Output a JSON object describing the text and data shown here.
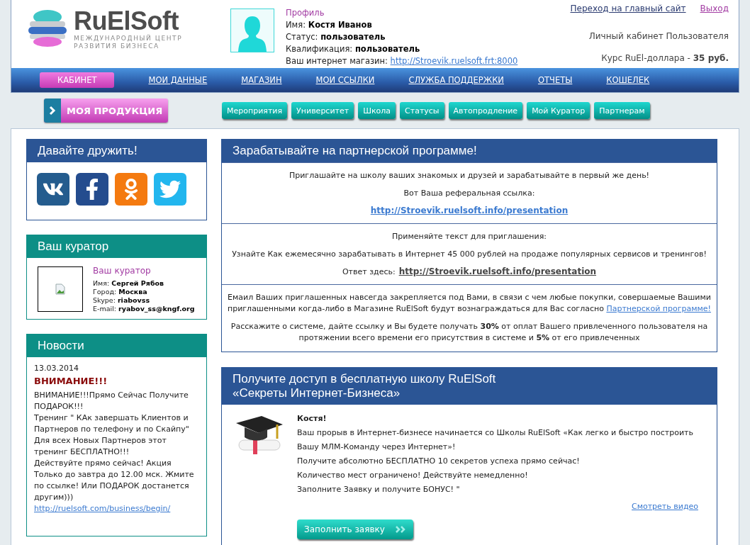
{
  "header": {
    "logo": {
      "name": "RuElSoft",
      "tagline": [
        "МЕЖДУНАРОДНЫЙ ЦЕНТР",
        "РАЗВИТИЯ БИЗНЕСА"
      ]
    },
    "profile": {
      "title": "Профиль",
      "fields": [
        {
          "label": "Имя:",
          "value": "Костя Иванов"
        },
        {
          "label": "Статус:",
          "value": "пользователь"
        },
        {
          "label": "Квалификация:",
          "value": "пользователь"
        }
      ],
      "shop_label": "Ваш интернет магазин:",
      "shop_link": "http://Stroevik.ruelsoft.frt:8000"
    },
    "links": [
      {
        "label": "Переход на главный сайт",
        "kind": "main"
      },
      {
        "label": "Выход",
        "kind": "exit"
      }
    ],
    "cabinet_label": "Личный кабинет Пользователя",
    "rate": {
      "label": "Курс RuEl-доллара -",
      "value": "35 руб."
    }
  },
  "nav": [
    {
      "label": "КАБИНЕТ",
      "selected": true
    },
    {
      "label": "МОИ ДАННЫЕ",
      "selected": false
    },
    {
      "label": "МАГАЗИН",
      "selected": false
    },
    {
      "label": "МОИ ССЫЛКИ",
      "selected": false
    },
    {
      "label": "СЛУЖБА ПОДДЕРЖКИ",
      "selected": false
    },
    {
      "label": "ОТЧЕТЫ",
      "selected": false
    },
    {
      "label": "КОШЕЛЕК",
      "selected": false
    }
  ],
  "product_button": "МОЯ ПРОДУКЦИЯ",
  "subnav": [
    "Мероприятия",
    "Университет",
    "Школа",
    "Статусы",
    "Автопродление",
    "Мой Куратор",
    "Партнерам"
  ],
  "friends": {
    "title": "Давайте дружить!"
  },
  "curator": {
    "title": "Ваш куратор",
    "subtitle": "Ваш куратор",
    "fields": [
      {
        "label": "Имя:",
        "value": "Сергей Рябов"
      },
      {
        "label": "Город:",
        "value": "Москва"
      },
      {
        "label": "Skype:",
        "value": "riabovss"
      },
      {
        "label": "E-mail:",
        "value": "ryabov_ss@kngf.org"
      }
    ]
  },
  "news": {
    "title": "Новости",
    "date": "13.03.2014",
    "headline": "ВНИМАНИЕ!!!",
    "lines": [
      "ВНИМАНИЕ!!!Прямо Сейчас Получите ПОДАРОК!!!",
      "Тренинг \" КАк завершать Клиентов и Партнеров по телефону и по Скайпу\"",
      "Для всех Новых Партнеров этот тренинг БЕСПЛАТНО!!!",
      "Действуйте прямо сейчас! Акция Только до завтра до 12.00 мск. Жмите по ссылке! Или ПОДАРОК достанется другим)))"
    ],
    "link": "http://ruelsoft.com/business/begin/"
  },
  "partner": {
    "title": "Зарабатывайте на партнерской программе!",
    "sections": [
      {
        "paragraphs": [
          {
            "kind": "text",
            "text": "Приглашайте на школу ваших знакомых и друзей и зарабатывайте в первый же день!"
          },
          {
            "kind": "text",
            "text": "Вот Ваша реферальная ссылка:"
          },
          {
            "kind": "link",
            "link": "http://Stroevik.ruelsoft.info/presentation"
          }
        ]
      },
      {
        "paragraphs": [
          {
            "kind": "text",
            "text": "Применяйте текст для приглашения:"
          },
          {
            "kind": "text",
            "text": "Узнайте Как ежемесячно зарабатывать в Интернет 45 000 рублей на продаже популярных сервисов и тренингов!"
          },
          {
            "kind": "answer",
            "text": "Ответ здесь:",
            "link": "http://Stroevik.ruelsoft.info/presentation"
          }
        ]
      },
      {
        "paragraphs": [
          {
            "kind": "inline",
            "text": "Емаил Ваших приглашенных навсегда закрепляется под Вами, в связи с чем любые покупки, совершаемые Вашими приглашенными когда-либо в Магазине RuElSoft будут вознаграждаться для Вас согласно",
            "link": "Партнерской программе!"
          },
          {
            "kind": "text",
            "text": "Расскажите о системе, дайте ссылку и Вы будете получать **30%** от оплат Вашего привлеченного пользователя на протяжении всего времени его присутствия в системе и **5%** от его привлеченных"
          }
        ]
      }
    ]
  },
  "school": {
    "title": [
      "Получите доступ в бесплатную школу RuElSoft",
      "«Секреты Интернет-Бизнеса»"
    ],
    "greeting": "Костя!",
    "lines": [
      "Ваш прорыв в Интернет-бизнесе начинается со Школы RuElSoft «Как легко и быстро построить Вашу МЛМ-Команду через Интернет»!",
      "Получите абсолютно БЕСПЛАТНО 10 секретов успеха прямо сейчас!",
      "Количество мест ограничено! Действуйте немедленно!",
      "Заполните Заявку и получите БОНУС! \""
    ],
    "video_link": "Смотреть видео",
    "button": "Заполнить заявку"
  }
}
